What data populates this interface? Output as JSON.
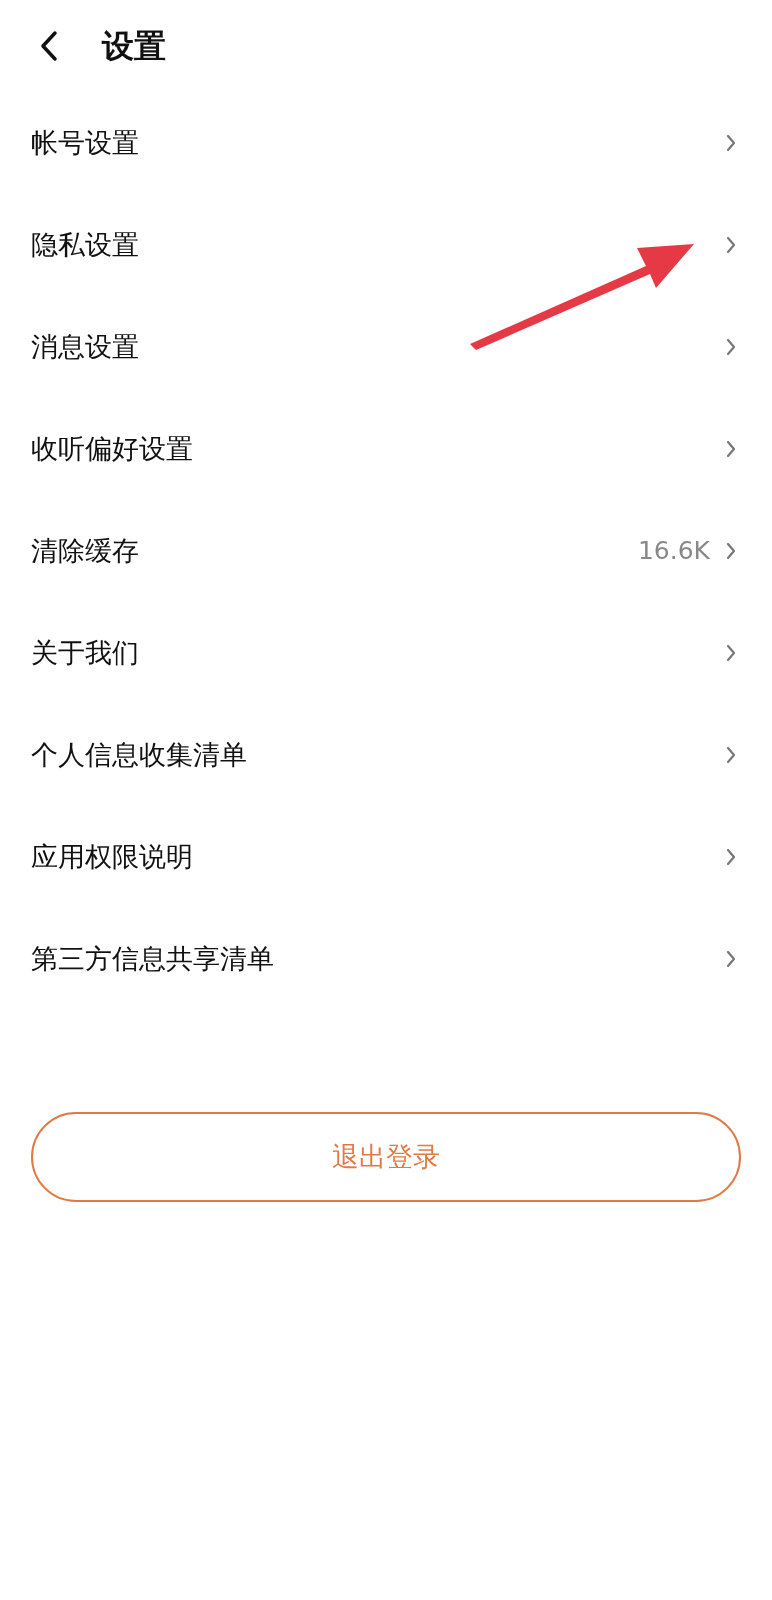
{
  "header": {
    "title": "设置"
  },
  "items": [
    {
      "label": "帐号设置"
    },
    {
      "label": "隐私设置"
    },
    {
      "label": "消息设置"
    },
    {
      "label": "收听偏好设置"
    },
    {
      "label": "清除缓存",
      "value": "16.6K"
    },
    {
      "label": "关于我们"
    },
    {
      "label": "个人信息收集清单"
    },
    {
      "label": "应用权限说明"
    },
    {
      "label": "第三方信息共享清单"
    }
  ],
  "logout_button": {
    "label": "退出登录"
  }
}
